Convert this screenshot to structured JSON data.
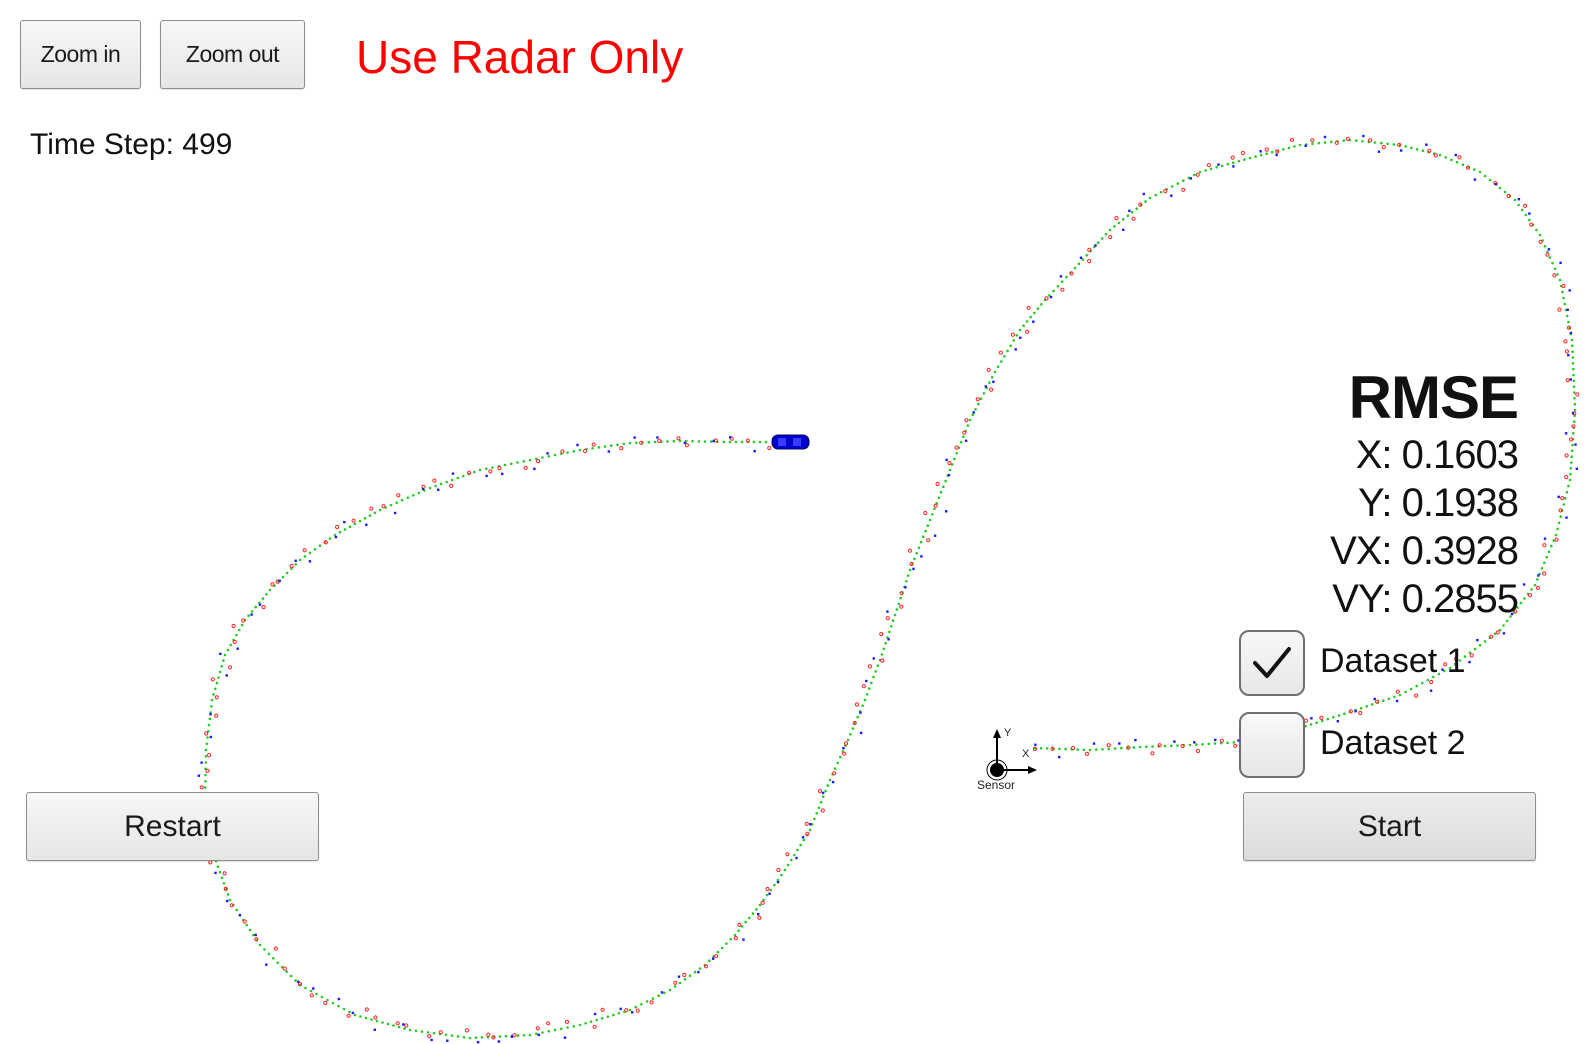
{
  "toolbar": {
    "zoom_in_label": "Zoom in",
    "zoom_out_label": "Zoom out"
  },
  "mode_title": "Use Radar Only",
  "status": {
    "time_step_label": "Time Step: 499"
  },
  "rmse": {
    "title": "RMSE",
    "x": "X: 0.1603",
    "y": "Y: 0.1938",
    "vx": "VX: 0.3928",
    "vy": "VY: 0.2855"
  },
  "datasets": [
    {
      "label": "Dataset 1",
      "checked": true
    },
    {
      "label": "Dataset 2",
      "checked": false
    }
  ],
  "controls": {
    "restart_label": "Restart",
    "start_label": "Start"
  },
  "sensor": {
    "label": "Sensor",
    "x_axis_label": "X",
    "y_axis_label": "Y"
  },
  "colors": {
    "mode_title": "#ff0000",
    "ground_truth": "#22cc22",
    "radar_measurement": "#ff2222",
    "estimate": "#1a1aff",
    "vehicle": "#0000cc"
  }
}
